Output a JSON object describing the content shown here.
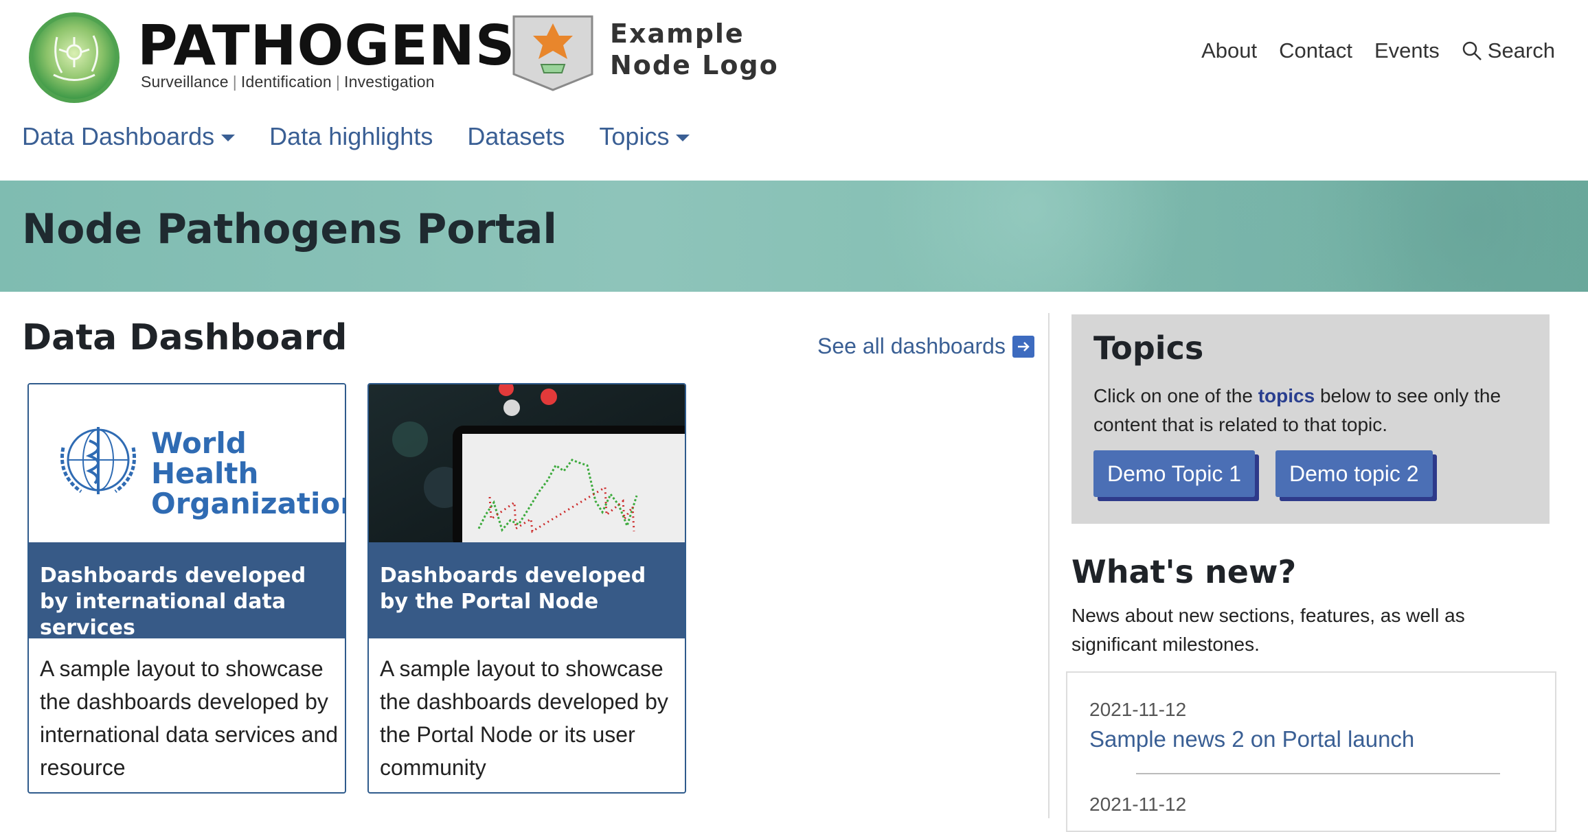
{
  "brand": {
    "title": "PATHOGENS",
    "tagline_parts": [
      "Surveillance",
      "Identification",
      "Investigation"
    ],
    "node_logo_line1": "Example",
    "node_logo_line2": "Node Logo"
  },
  "top_nav": {
    "about": "About",
    "contact": "Contact",
    "events": "Events",
    "search": "Search"
  },
  "main_nav": {
    "data_dashboards": "Data Dashboards",
    "data_highlights": "Data highlights",
    "datasets": "Datasets",
    "topics": "Topics"
  },
  "banner": {
    "title": "Node Pathogens Portal"
  },
  "dashboard_section": {
    "title": "Data Dashboard",
    "see_all": "See all dashboards",
    "cards": [
      {
        "image_label_line1": "World Health",
        "image_label_line2": "Organization",
        "heading": "Dashboards developed by international data services",
        "description": "A sample layout to showcase the dashboards developed by international data services and resource"
      },
      {
        "heading": "Dashboards developed by the Portal Node",
        "description": "A sample layout to showcase the dashboards developed by the Portal Node or its user community"
      }
    ]
  },
  "topics_panel": {
    "title": "Topics",
    "text_before": "Click on one of the ",
    "text_keyword": "topics",
    "text_after": " below to see only the content that is related to that topic.",
    "buttons": [
      "Demo Topic 1",
      "Demo topic 2"
    ]
  },
  "whats_new": {
    "title": "What's new?",
    "description": "News about new sections, features, as well as significant milestones.",
    "items": [
      {
        "date": "2021-11-12",
        "title": "Sample news 2 on Portal launch"
      },
      {
        "date": "2021-11-12",
        "title": ""
      }
    ]
  },
  "colors": {
    "link_blue": "#3a5f94",
    "card_band": "#375a87",
    "topic_button": "#4b6fb5",
    "banner_teal": "#86c0b4"
  },
  "icons": {
    "pathogens_logo": "green-virus-logo-icon",
    "node_logo": "orange-star-shield-icon",
    "search": "magnifier-icon",
    "see_all_arrow": "arrow-right-icon"
  }
}
